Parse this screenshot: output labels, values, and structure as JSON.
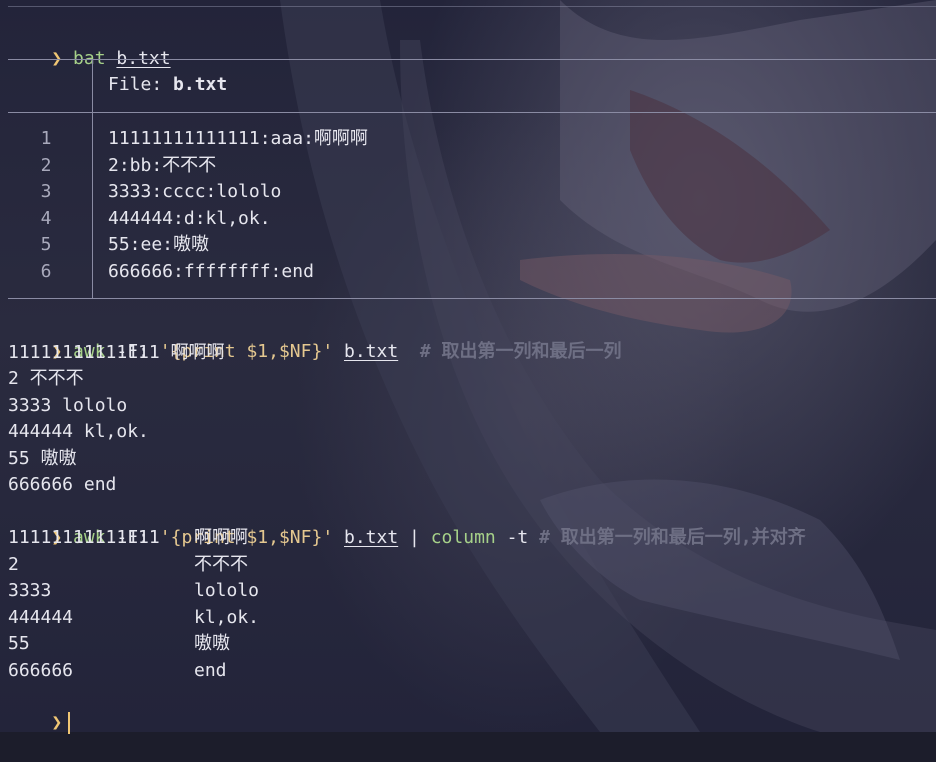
{
  "prompt_symbol": "❯",
  "cmd1": {
    "program": "bat",
    "file": "b.txt"
  },
  "bat_output": {
    "header_label": "File:",
    "header_file": "b.txt",
    "lines": [
      {
        "num": "1",
        "text": "11111111111111:aaa:啊啊啊"
      },
      {
        "num": "2",
        "text": "2:bb:不不不"
      },
      {
        "num": "3",
        "text": "3333:cccc:lololo"
      },
      {
        "num": "4",
        "text": "444444:d:kl,ok."
      },
      {
        "num": "5",
        "text": "55:ee:嗷嗷"
      },
      {
        "num": "6",
        "text": "666666:ffffffff:end"
      }
    ]
  },
  "cmd2": {
    "program": "awk",
    "option": "-F:",
    "script": "'{print $1,$NF}'",
    "file": "b.txt",
    "comment": "# 取出第一列和最后一列"
  },
  "awk_output": [
    "11111111111111 啊啊啊",
    "2 不不不",
    "3333 lololo",
    "444444 kl,ok.",
    "55 嗷嗷",
    "666666 end"
  ],
  "cmd3": {
    "program": "awk",
    "option": "-F:",
    "script": "'{print $1,$NF}'",
    "file": "b.txt",
    "pipe": "|",
    "program2": "column",
    "option2": "-t",
    "comment": "# 取出第一列和最后一列,并对齐"
  },
  "column_output": [
    {
      "c1": "11111111111111",
      "c2": "啊啊啊"
    },
    {
      "c1": "2",
      "c2": "不不不"
    },
    {
      "c1": "3333",
      "c2": "lololo"
    },
    {
      "c1": "444444",
      "c2": "kl,ok."
    },
    {
      "c1": "55",
      "c2": "嗷嗷"
    },
    {
      "c1": "666666",
      "c2": "end"
    }
  ],
  "colors": {
    "prompt": "#f0c674",
    "command": "#a6d189",
    "string": "#e5c890",
    "comment": "#6e6f84",
    "text": "#e6e6ee",
    "background": "#1c1d2b"
  }
}
